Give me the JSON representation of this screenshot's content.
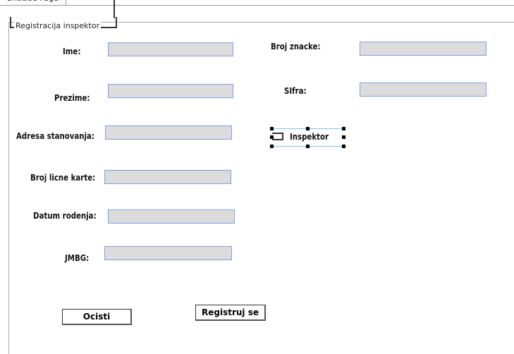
{
  "tab": {
    "title": "Untitled Page"
  },
  "group": {
    "legend": "Registracija inspektor"
  },
  "fields": [
    {
      "label": "Ime:",
      "value": ""
    },
    {
      "label": "Prezime:",
      "value": ""
    },
    {
      "label": "Adresa stanovanja:",
      "value": ""
    },
    {
      "label": "Broj licne karte:",
      "value": ""
    },
    {
      "label": "Datum rodenja:",
      "value": ""
    },
    {
      "label": "JMBG:",
      "value": ""
    },
    {
      "label": "Broj znacke:",
      "value": ""
    },
    {
      "label": "SIfra:",
      "value": ""
    }
  ],
  "checkbox": {
    "label": "Inspektor",
    "checked": false
  },
  "buttons": {
    "clear": "Ocisti",
    "register": "Registruj se"
  }
}
